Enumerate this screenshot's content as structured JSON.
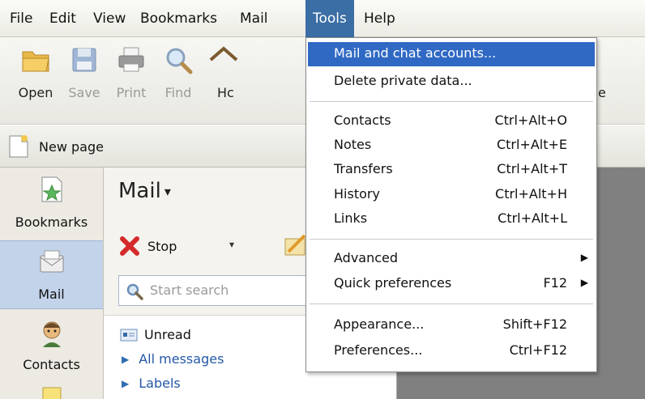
{
  "menubar": {
    "items": [
      "File",
      "Edit",
      "View",
      "Bookmarks",
      "Mail",
      "Tools",
      "Help"
    ],
    "active": "Tools"
  },
  "toolbar": {
    "open": "Open",
    "save": "Save",
    "print": "Print",
    "find": "Find",
    "home_partial": "Hc",
    "right_partial": "e"
  },
  "tabbar": {
    "new_page": "New page"
  },
  "sidepanel": {
    "bookmarks": "Bookmarks",
    "mail": "Mail",
    "contacts": "Contacts"
  },
  "mailpanel": {
    "title": "Mail",
    "title_caret": "▾",
    "stop": "Stop",
    "stop_dd": "▾",
    "search_placeholder": "Start search",
    "folders": {
      "unread": "Unread",
      "all_messages": "All messages",
      "labels": "Labels"
    }
  },
  "tools_menu": {
    "mail_chat_accounts": "Mail and chat accounts...",
    "delete_private_data": "Delete private data...",
    "contacts": {
      "label": "Contacts",
      "shortcut": "Ctrl+Alt+O"
    },
    "notes": {
      "label": "Notes",
      "shortcut": "Ctrl+Alt+E"
    },
    "transfers": {
      "label": "Transfers",
      "shortcut": "Ctrl+Alt+T"
    },
    "history": {
      "label": "History",
      "shortcut": "Ctrl+Alt+H"
    },
    "links": {
      "label": "Links",
      "shortcut": "Ctrl+Alt+L"
    },
    "advanced": {
      "label": "Advanced",
      "arrow": "▶"
    },
    "quick_preferences": {
      "label": "Quick preferences",
      "shortcut": "F12",
      "arrow": "▶"
    },
    "appearance": {
      "label": "Appearance...",
      "shortcut": "Shift+F12"
    },
    "preferences": {
      "label": "Preferences...",
      "shortcut": "Ctrl+F12"
    }
  },
  "colors": {
    "menu_highlight": "#3069c4",
    "active_menu": "#3a6ea5",
    "content_bg": "#808080",
    "link": "#2458a6"
  },
  "icons": [
    "folder-open-icon",
    "save-icon",
    "print-icon",
    "find-icon",
    "home-icon",
    "new-page-icon",
    "bookmarks-icon",
    "mail-icon",
    "contacts-icon",
    "notes-icon",
    "stop-icon",
    "compose-icon",
    "search-icon",
    "unread-icon",
    "expand-triangle-icon"
  ]
}
